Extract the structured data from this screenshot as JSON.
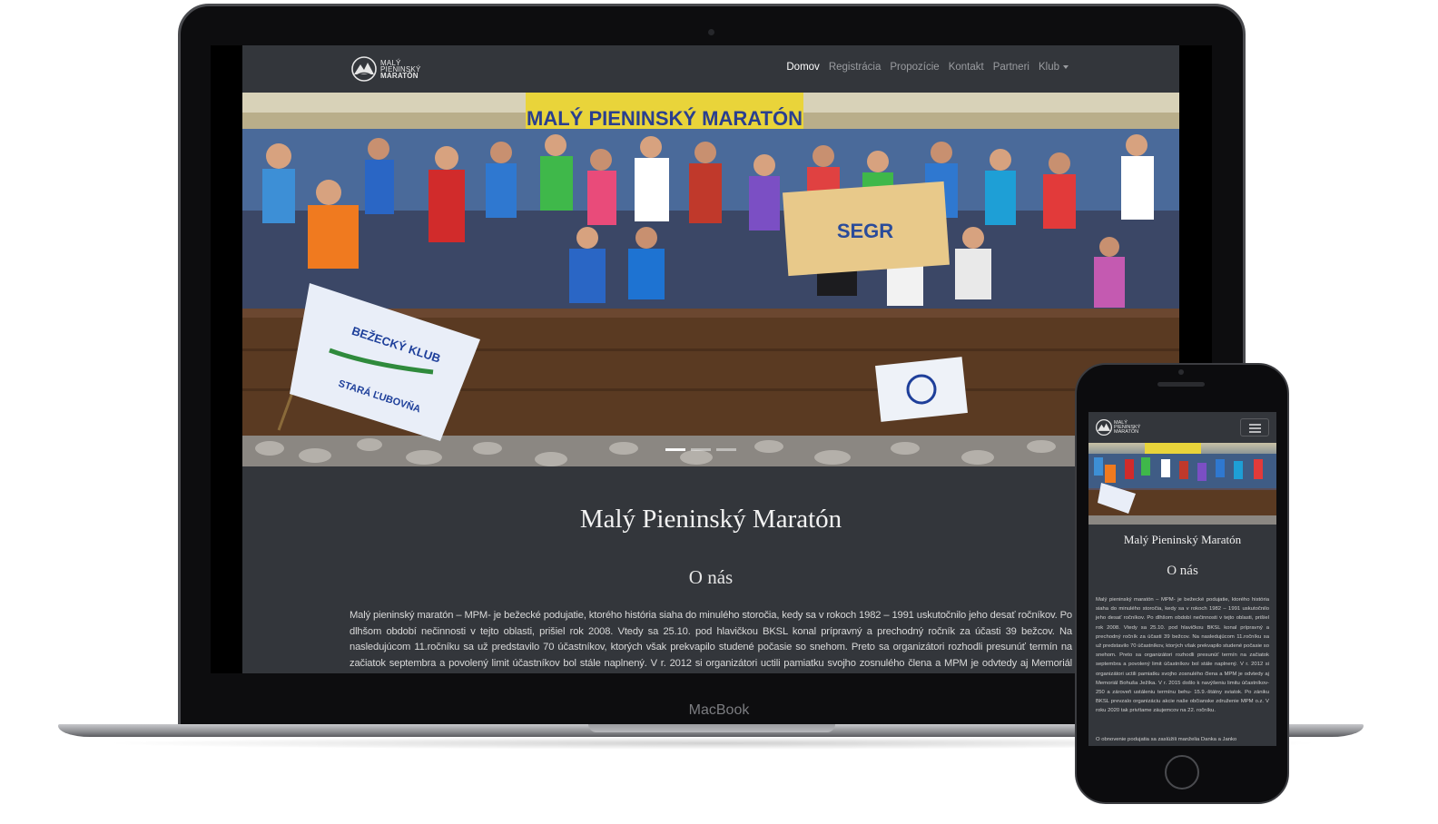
{
  "site": {
    "logo_line1": "MALÝ",
    "logo_line2": "PIENINSKÝ",
    "logo_line3": "MARATÓN",
    "nav": [
      {
        "label": "Domov",
        "active": true
      },
      {
        "label": "Registrácia",
        "active": false
      },
      {
        "label": "Propozície",
        "active": false
      },
      {
        "label": "Kontakt",
        "active": false
      },
      {
        "label": "Partneri",
        "active": false
      },
      {
        "label": "Klub",
        "active": false,
        "dropdown": true
      }
    ],
    "hero": {
      "banner_text": "MALÝ PIENINSKÝ MARATÓN",
      "flag_text_top": "BEŽECKÝ KLUB",
      "flag_text_bottom": "STARÁ ĽUBOVŇA",
      "sponsor_text": "SEGR",
      "slides": 3,
      "active_slide": 1
    },
    "title": "Malý Pieninský Maratón",
    "subtitle": "O nás",
    "body": "Malý pieninský maratón – MPM- je bežecké podujatie, ktorého história siaha do minulého storočia, kedy sa v rokoch 1982 – 1991 uskutočnilo jeho desať ročníkov. Po dlhšom období nečinnosti v tejto oblasti, prišiel rok 2008. Vtedy sa 25.10. pod hlavičkou BKSL konal prípravný a prechodný ročník za účasti 39 bežcov. Na nasledujúcom 11.ročníku sa už predstavilo 70 účastníkov, ktorých však prekvapilo studené počasie so snehom. Preto sa organizátori rozhodli presunúť termín na začiatok septembra a povolený limit účastníkov bol stále naplnený. V r. 2012 si organizátori uctili pamiatku svojho zosnulého člena a MPM je odvtedy aj Memoriál Bohuša Ježíka. V r. 2015 došlo k navýšeniu limitu účastníkov-250",
    "body_mobile": "Malý pieninský maratón – MPM- je bežecké podujatie, ktorého história siaha do minulého storočia, kedy sa v rokoch 1982 – 1991 uskutočnilo jeho desať ročníkov. Po dlhšom období nečinnosti v tejto oblasti, prišiel rok 2008. Vtedy sa 25.10. pod hlavičkou BKSL konal prípravný a prechodný ročník za účasti 39 bežcov. Na nasledujúcom 11.ročníku sa už predstavilo 70 účastníkov, ktorých však prekvapilo studené počasie so snehom. Preto sa organizátori rozhodli presunúť termín na začiatok septembra a povolený limit účastníkov bol stále naplnený. V r. 2012 si organizátori uctili pamiatku svojho zosnulého člena a MPM je odvtedy aj Memoriál Bohuša Ježíka. V r. 2015 došlo k navýšeniu limitu účastníkov-250 a zároveň ustáleniu termínu behu- 15.9.-štátny sviatok. Po zániku BKSL prevzalo organizáciu akcie naše občianske združenie MPM o.z. V roku 2020 tak privítame záujemcov na 22. ročníku.",
    "body_mobile_2": "O obnovenie podujatia sa zaslúžili manželia Danka a Janko"
  },
  "device": {
    "laptop_label": "MacBook"
  },
  "colors": {
    "site_bg": "#33363b",
    "nav_active": "#ffffff",
    "nav_inactive": "#9a9ca0",
    "device_frame": "#0d0d0f"
  },
  "icons": [
    "mountain-logo-icon",
    "caret-down-icon",
    "hamburger-menu-icon"
  ]
}
